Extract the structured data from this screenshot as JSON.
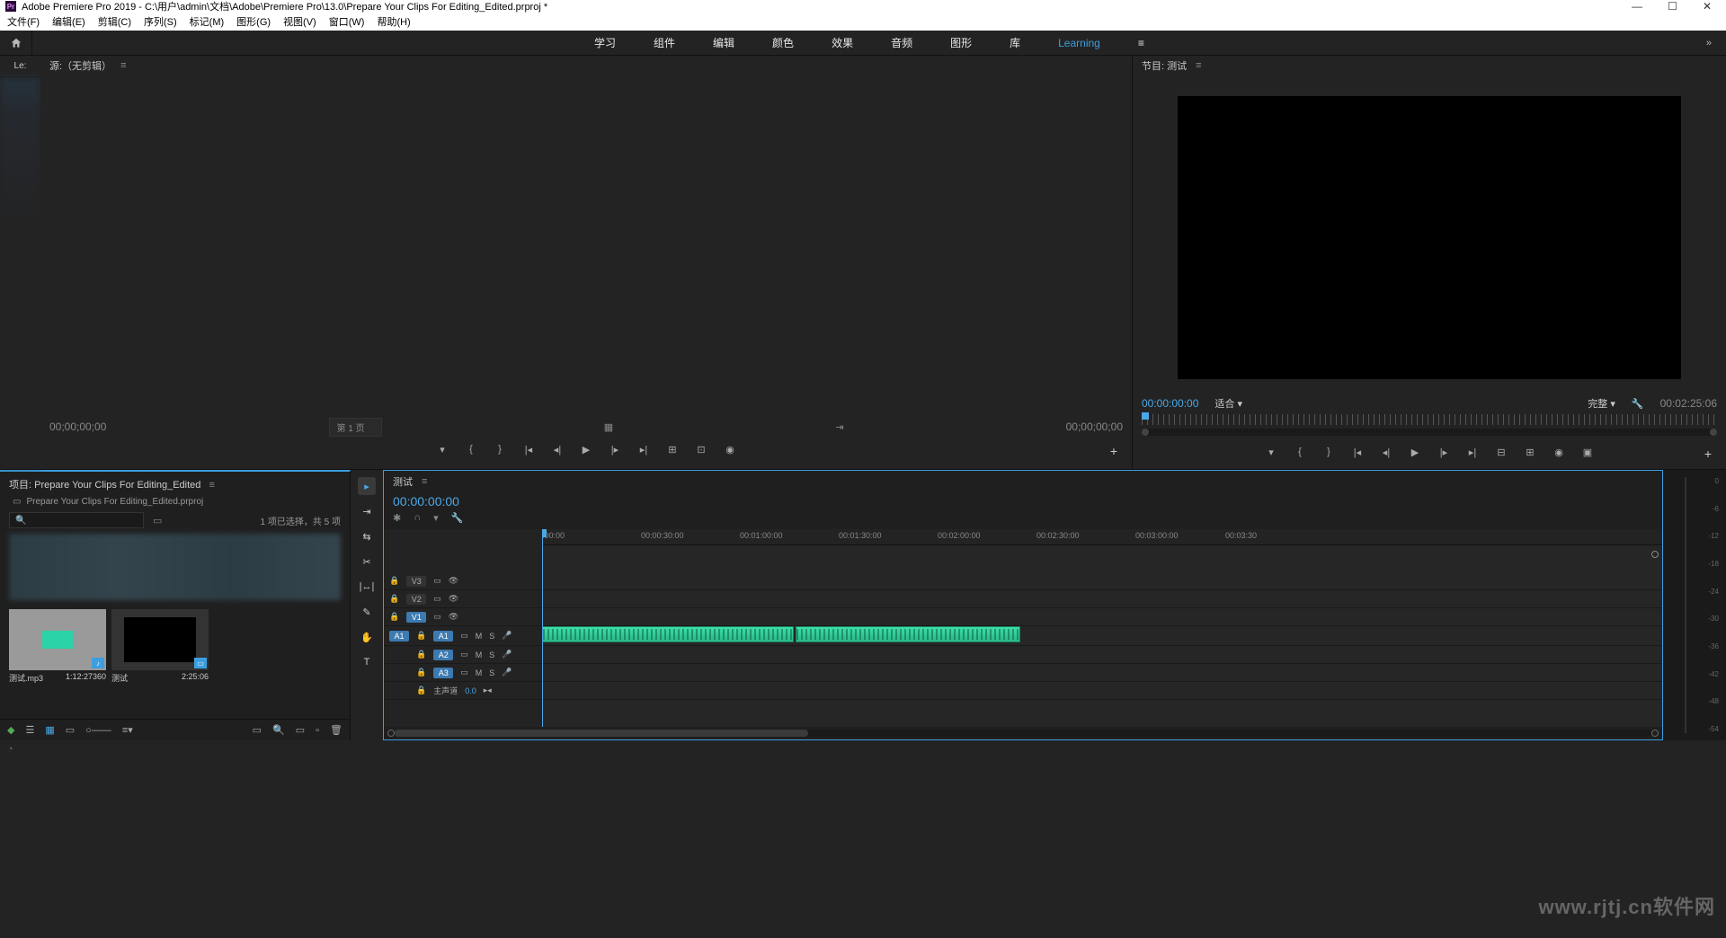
{
  "title": "Adobe Premiere Pro 2019 - C:\\用户\\admin\\文档\\Adobe\\Premiere Pro\\13.0\\Prepare Your Clips For Editing_Edited.prproj *",
  "menubar": [
    "文件(F)",
    "编辑(E)",
    "剪辑(C)",
    "序列(S)",
    "标记(M)",
    "图形(G)",
    "视图(V)",
    "窗口(W)",
    "帮助(H)"
  ],
  "workspaces": [
    "学习",
    "组件",
    "编辑",
    "颜色",
    "效果",
    "音频",
    "图形",
    "库"
  ],
  "workspace_active": "Learning",
  "leftrail_tab": "Le:",
  "source": {
    "title": "源:（无剪辑）",
    "tc_left": "00;00;00;00",
    "tc_right": "00;00;00;00",
    "page": "第 1 页"
  },
  "program": {
    "title": "节目: 测试",
    "tc_left": "00:00:00:00",
    "fit": "适合",
    "quality": "完整",
    "tc_right": "00:02:25:06"
  },
  "project": {
    "title": "项目: Prepare Your Clips For Editing_Edited",
    "file": "Prepare Your Clips For Editing_Edited.prproj",
    "selection": "1 项已选择，共 5 项",
    "items": [
      {
        "name": "测试.mp3",
        "dur": "1:12:27360"
      },
      {
        "name": "测试",
        "dur": "2:25:06"
      }
    ]
  },
  "timeline": {
    "name": "测试",
    "tc": "00:00:00:00",
    "ruler": [
      ":00:00",
      "00:00:30:00",
      "00:01:00:00",
      "00:01:30:00",
      "00:02:00:00",
      "00:02:30:00",
      "00:03:00:00",
      "00:03:30"
    ],
    "tracks_v": [
      "V3",
      "V2",
      "V1"
    ],
    "tracks_a": [
      "A1",
      "A2",
      "A3"
    ],
    "master": "主声道",
    "master_val": "0.0"
  },
  "meter_scale": [
    "0",
    "-6",
    "-12",
    "-18",
    "-24",
    "-30",
    "-36",
    "-42",
    "-48",
    "-54"
  ],
  "watermark": "www.rjtj.cn软件网"
}
